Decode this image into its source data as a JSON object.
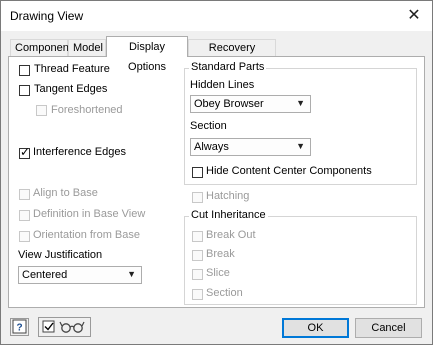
{
  "dialog": {
    "title": "Drawing View"
  },
  "tabs": [
    {
      "label": "Component"
    },
    {
      "label": "Model"
    },
    {
      "label": "Display Options"
    },
    {
      "label": "Recovery Options"
    }
  ],
  "left": {
    "thread_feature": {
      "label": "Thread Feature",
      "checked": false
    },
    "tangent_edges": {
      "label": "Tangent Edges",
      "checked": false
    },
    "foreshortened": {
      "label": "Foreshortened",
      "checked": false,
      "enabled": false
    },
    "interference_edges": {
      "label": "Interference Edges",
      "checked": true
    },
    "align_to_base": {
      "label": "Align to Base",
      "enabled": false
    },
    "definition_in_base_view": {
      "label": "Definition in Base View",
      "enabled": false
    },
    "orientation_from_base": {
      "label": "Orientation from Base",
      "enabled": false
    },
    "view_justification": {
      "label": "View Justification",
      "value": "Centered"
    }
  },
  "standard_parts": {
    "title": "Standard Parts",
    "hidden_lines": {
      "label": "Hidden Lines",
      "value": "Obey Browser"
    },
    "section": {
      "label": "Section",
      "value": "Always"
    },
    "hide_content_center": {
      "label": "Hide Content Center Components",
      "checked": false
    }
  },
  "hatching": {
    "label": "Hatching",
    "enabled": false
  },
  "cut_inheritance": {
    "title": "Cut Inheritance",
    "break_out": "Break Out",
    "break": "Break",
    "slice": "Slice",
    "section": "Section"
  },
  "footer": {
    "ok_label": "OK",
    "cancel_label": "Cancel",
    "help_icon": "help-icon",
    "preview_icon": "glasses-icon"
  },
  "colors": {
    "accent": "#0078d7",
    "disabled_text": "#9a9a9a"
  }
}
